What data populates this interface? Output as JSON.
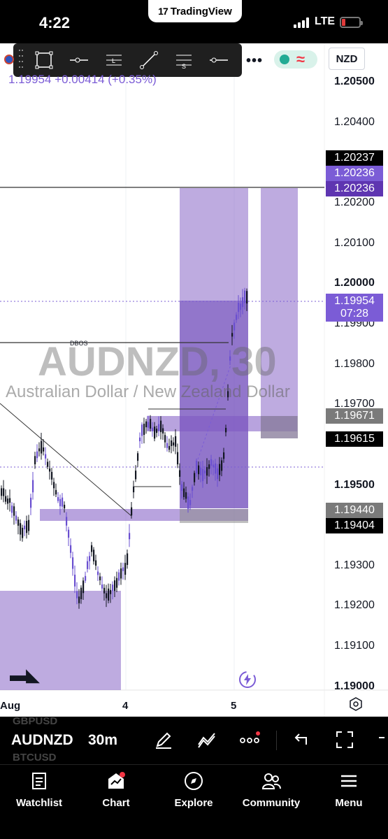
{
  "status_bar": {
    "time": "4:22",
    "app_pill": "TradingView",
    "network": "LTE"
  },
  "chart_header": {
    "ohlc_readout": "1.19954 +0.00414 (+0.35%)",
    "quote_currency": "NZD"
  },
  "watermark": {
    "title": "AUDNZD, 30",
    "subtitle": "Australian Dollar / New Zealand Dollar"
  },
  "annotations": {
    "dbos_label": "DBOS"
  },
  "price_axis": {
    "labels": [
      {
        "text": "1.20500",
        "bold": true
      },
      {
        "text": "1.20400",
        "bold": false
      },
      {
        "text": "1.20200",
        "bold": false
      },
      {
        "text": "1.20100",
        "bold": false
      },
      {
        "text": "1.20000",
        "bold": true
      },
      {
        "text": "1.19900",
        "bold": false
      },
      {
        "text": "1.19800",
        "bold": false
      },
      {
        "text": "1.19700",
        "bold": false
      },
      {
        "text": "1.19500",
        "bold": true
      },
      {
        "text": "1.19300",
        "bold": false
      },
      {
        "text": "1.19200",
        "bold": false
      },
      {
        "text": "1.19100",
        "bold": false
      },
      {
        "text": "1.19000",
        "bold": true
      }
    ],
    "tags": {
      "high_tag": "1.20237",
      "zone_top_1": "1.20236",
      "zone_top_2": "1.20236",
      "last_price": "1.19954",
      "countdown": "07:28",
      "level_1": "1.19671",
      "level_2": "1.19615",
      "level_3": "1.19440",
      "level_4": "1.19404"
    }
  },
  "time_axis": {
    "labels": [
      "Aug",
      "4",
      "5"
    ]
  },
  "symbol_bar": {
    "ghost_top": "GBPUSD",
    "ghost_bottom": "BTCUSD",
    "symbol": "AUDNZD",
    "interval": "30m"
  },
  "bottom_nav": {
    "items": [
      {
        "label": "Watchlist",
        "icon": "watchlist-icon"
      },
      {
        "label": "Chart",
        "icon": "chart-icon"
      },
      {
        "label": "Explore",
        "icon": "compass-icon"
      },
      {
        "label": "Community",
        "icon": "community-icon"
      },
      {
        "label": "Menu",
        "icon": "menu-icon"
      }
    ]
  },
  "colors": {
    "accent_purple": "#7b5cd6",
    "zone_purple": "#7e57c2",
    "candle": "#131722",
    "candle_purple": "#6a4fd0",
    "up_green": "#22ab94",
    "down_red": "#f23645"
  }
}
